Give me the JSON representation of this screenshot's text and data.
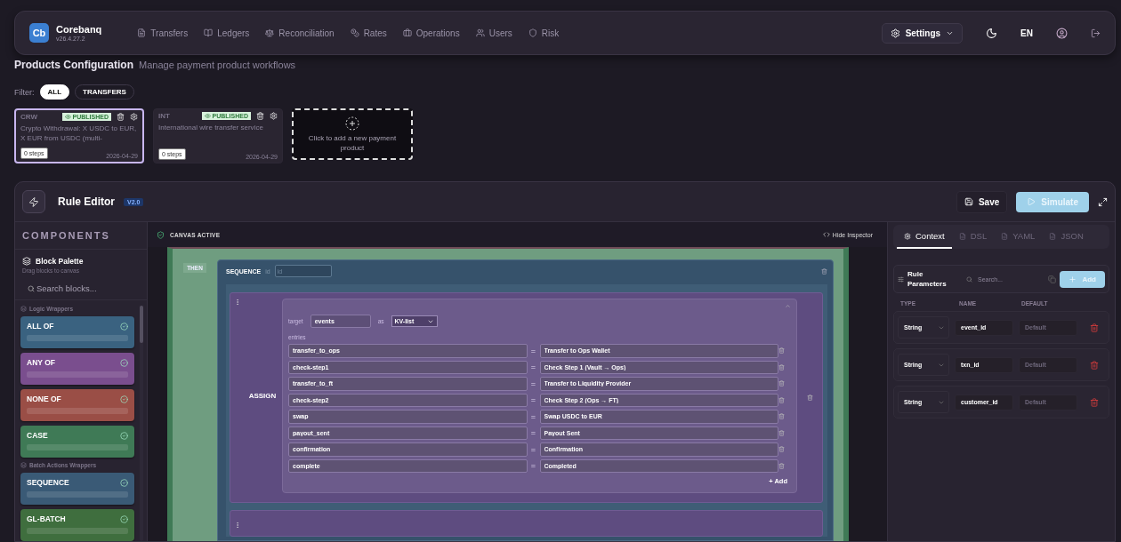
{
  "app": {
    "logo": "Cb",
    "name": "Corebanq",
    "version": "v26.4.27.2"
  },
  "nav": [
    {
      "label": "Transfers"
    },
    {
      "label": "Ledgers"
    },
    {
      "label": "Reconciliation"
    },
    {
      "label": "Rates"
    },
    {
      "label": "Operations"
    },
    {
      "label": "Users"
    },
    {
      "label": "Risk"
    }
  ],
  "header_actions": {
    "settings": "Settings",
    "language": "EN"
  },
  "page": {
    "title": "Products Configuration",
    "subtitle": "Manage payment product workflows"
  },
  "filter": {
    "label": "Filter:",
    "chips": [
      {
        "label": "ALL",
        "selected": true
      },
      {
        "label": "TRANSFERS",
        "selected": false
      }
    ]
  },
  "products": [
    {
      "code": "CRW",
      "status": "PUBLISHED",
      "description": "Crypto Withdrawal: X USDC to EUR, X EUR from USDC (multi-",
      "steps": "0 steps",
      "date": "2026-04-29",
      "selected": true
    },
    {
      "code": "INT",
      "status": "PUBLISHED",
      "description": "International wire transfer service",
      "steps": "0 steps",
      "date": "2026-04-29",
      "selected": false
    }
  ],
  "add_product": "Click to add a new payment product",
  "editor": {
    "title": "Rule Editor",
    "version": "V2.0",
    "save": "Save",
    "simulate": "Simulate"
  },
  "palette": {
    "heading": "COMPONENTS",
    "title": "Block Palette",
    "subtitle": "Drag blocks to canvas",
    "search_placeholder": "Search blocks...",
    "groups": [
      {
        "label": "Logic Wrappers",
        "blocks": [
          {
            "label": "ALL OF",
            "color": "#3a6280"
          },
          {
            "label": "ANY OF",
            "color": "#7a4e8e"
          },
          {
            "label": "NONE OF",
            "color": "#9a4e46"
          },
          {
            "label": "CASE",
            "color": "#3f7a56"
          }
        ]
      },
      {
        "label": "Batch Actions Wrappers",
        "blocks": [
          {
            "label": "SEQUENCE",
            "color": "#3a5a76"
          },
          {
            "label": "GL-BATCH",
            "color": "#3f6e3e"
          }
        ]
      }
    ]
  },
  "canvas": {
    "status": "CANVAS ACTIVE",
    "hide_inspector": "Hide Inspector",
    "then_label": "THEN",
    "sequence": {
      "label": "SEQUENCE",
      "id_label": "id",
      "id_placeholder": "id"
    },
    "assign": {
      "label": "ASSIGN",
      "target_label": "target",
      "target": "events",
      "as_label": "as",
      "format": "KV-list",
      "entries_label": "entries",
      "add": "+ Add",
      "entries": [
        {
          "key": "transfer_to_ops",
          "separator": "=",
          "value": "Transfer to Ops Wallet"
        },
        {
          "key": "check-step1",
          "separator": "=",
          "value": "Check Step 1 (Vault → Ops)"
        },
        {
          "key": "transfer_to_ft",
          "separator": "=",
          "value": "Transfer to Liquidity Provider"
        },
        {
          "key": "check-step2",
          "separator": "=",
          "value": "Check Step 2 (Ops → FT)"
        },
        {
          "key": "swap",
          "separator": "=",
          "value": "Swap USDC to EUR"
        },
        {
          "key": "payout_sent",
          "separator": "=",
          "value": "Payout Sent"
        },
        {
          "key": "confirmation",
          "separator": "=",
          "value": "Confirmation"
        },
        {
          "key": "complete",
          "separator": "=",
          "value": "Completed"
        }
      ]
    }
  },
  "inspector": {
    "tabs": [
      {
        "label": "Context",
        "selected": true
      },
      {
        "label": "DSL",
        "selected": false
      },
      {
        "label": "YAML",
        "selected": false
      },
      {
        "label": "JSON",
        "selected": false
      }
    ],
    "parameters": {
      "title": "Rule Parameters",
      "search_placeholder": "Search...",
      "add": "Add",
      "columns": [
        "TYPE",
        "NAME",
        "DEFAULT"
      ],
      "rows": [
        {
          "type": "String",
          "name": "event_id",
          "default_placeholder": "Default"
        },
        {
          "type": "String",
          "name": "txn_id",
          "default_placeholder": "Default"
        },
        {
          "type": "String",
          "name": "customer_id",
          "default_placeholder": "Default"
        }
      ]
    }
  }
}
